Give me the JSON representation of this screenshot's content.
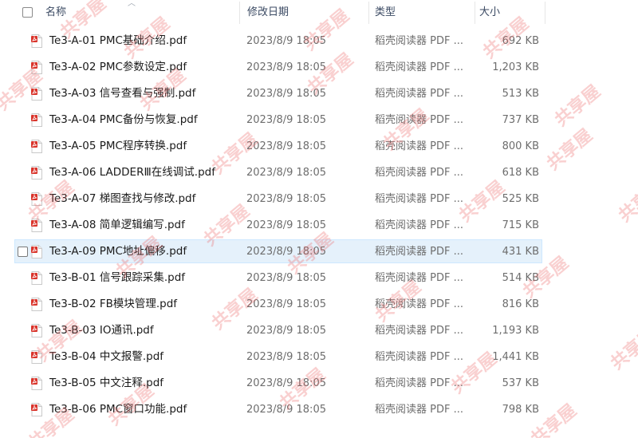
{
  "header": {
    "name": "名称",
    "date": "修改日期",
    "type": "类型",
    "size": "大小"
  },
  "files": [
    {
      "name": "Te3-A-01 PMC基础介绍.pdf",
      "date": "2023/8/9 18:05",
      "type": "稻壳阅读器 PDF ...",
      "size": "692 KB"
    },
    {
      "name": "Te3-A-02 PMC参数设定.pdf",
      "date": "2023/8/9 18:05",
      "type": "稻壳阅读器 PDF ...",
      "size": "1,203 KB"
    },
    {
      "name": "Te3-A-03 信号查看与强制.pdf",
      "date": "2023/8/9 18:05",
      "type": "稻壳阅读器 PDF ...",
      "size": "513 KB"
    },
    {
      "name": "Te3-A-04 PMC备份与恢复.pdf",
      "date": "2023/8/9 18:05",
      "type": "稻壳阅读器 PDF ...",
      "size": "737 KB"
    },
    {
      "name": "Te3-A-05 PMC程序转换.pdf",
      "date": "2023/8/9 18:05",
      "type": "稻壳阅读器 PDF ...",
      "size": "800 KB"
    },
    {
      "name": "Te3-A-06 LADDERⅢ在线调试.pdf",
      "date": "2023/8/9 18:05",
      "type": "稻壳阅读器 PDF ...",
      "size": "618 KB"
    },
    {
      "name": "Te3-A-07 梯图查找与修改.pdf",
      "date": "2023/8/9 18:05",
      "type": "稻壳阅读器 PDF ...",
      "size": "525 KB"
    },
    {
      "name": "Te3-A-08 简单逻辑编写.pdf",
      "date": "2023/8/9 18:05",
      "type": "稻壳阅读器 PDF ...",
      "size": "715 KB"
    },
    {
      "name": "Te3-A-09 PMC地址偏移.pdf",
      "date": "2023/8/9 18:05",
      "type": "稻壳阅读器 PDF ...",
      "size": "431 KB"
    },
    {
      "name": "Te3-B-01 信号跟踪采集.pdf",
      "date": "2023/8/9 18:05",
      "type": "稻壳阅读器 PDF ...",
      "size": "514 KB"
    },
    {
      "name": "Te3-B-02 FB模块管理.pdf",
      "date": "2023/8/9 18:05",
      "type": "稻壳阅读器 PDF ...",
      "size": "816 KB"
    },
    {
      "name": "Te3-B-03 IO通讯.pdf",
      "date": "2023/8/9 18:05",
      "type": "稻壳阅读器 PDF ...",
      "size": "1,193 KB"
    },
    {
      "name": "Te3-B-04 中文报警.pdf",
      "date": "2023/8/9 18:05",
      "type": "稻壳阅读器 PDF ...",
      "size": "1,441 KB"
    },
    {
      "name": "Te3-B-05 中文注释.pdf",
      "date": "2023/8/9 18:05",
      "type": "稻壳阅读器 PDF ...",
      "size": "537 KB"
    },
    {
      "name": "Te3-B-06 PMC窗口功能.pdf",
      "date": "2023/8/9 18:05",
      "type": "稻壳阅读器 PDF ...",
      "size": "798 KB"
    }
  ],
  "watermark_text": "共享屋",
  "colors": {
    "hover_bg": "#e5f1fb",
    "pdf_red": "#d9342b",
    "watermark": "#ec6262"
  },
  "icons": {
    "file": "pdf-file-icon",
    "sort": "sort-up-caret-icon"
  }
}
